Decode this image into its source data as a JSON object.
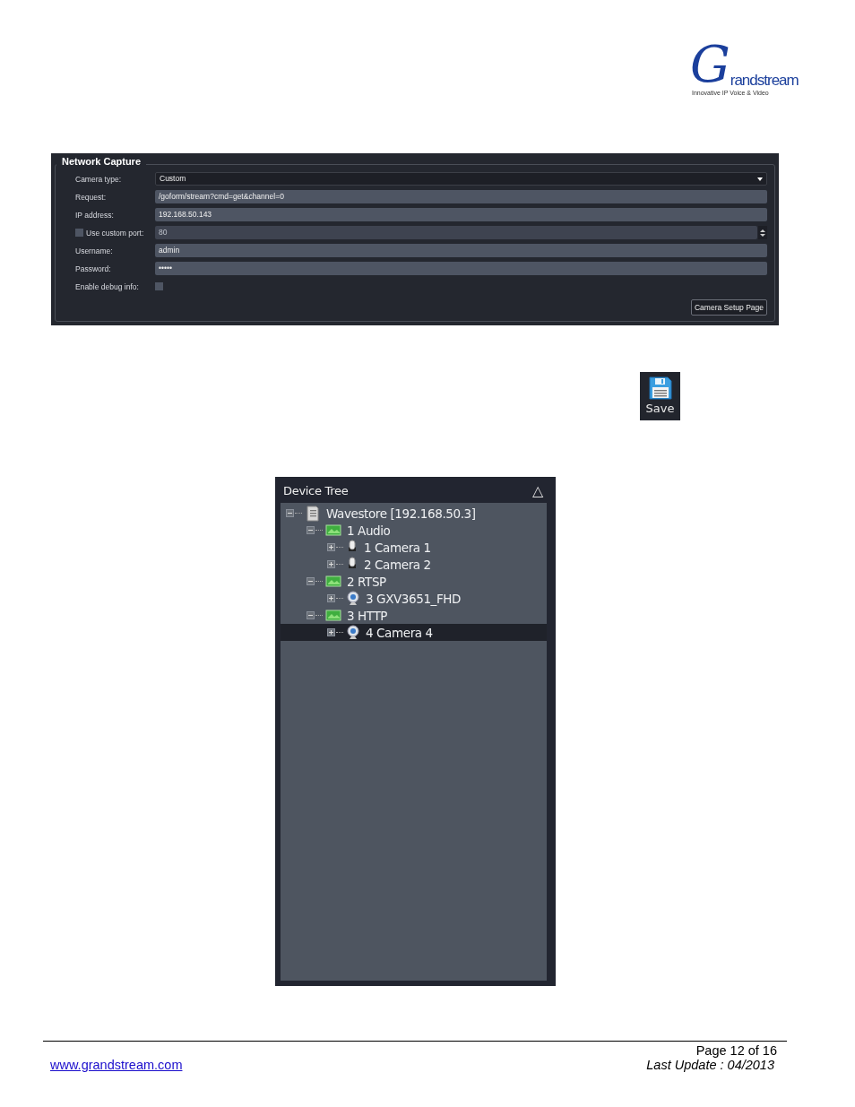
{
  "logo": {
    "initial": "G",
    "name": "randstream",
    "tagline": "Innovative IP Voice & Video"
  },
  "network_capture": {
    "title": "Network Capture",
    "fields": [
      {
        "label": "Camera type:",
        "kind": "select",
        "value": "Custom"
      },
      {
        "label": "Request:",
        "kind": "text",
        "value": "/goform/stream?cmd=get&channel=0"
      },
      {
        "label": "IP address:",
        "kind": "text",
        "value": "192.168.50.143"
      },
      {
        "label": "Use custom port:",
        "kind": "spin",
        "checked": false,
        "value": "80"
      },
      {
        "label": "Username:",
        "kind": "text",
        "value": "admin"
      },
      {
        "label": "Password:",
        "kind": "text",
        "value": "•••••"
      },
      {
        "label": "Enable debug info:",
        "kind": "check",
        "checked": false
      }
    ],
    "button": "Camera Setup Page"
  },
  "save_button": {
    "label": "Save"
  },
  "device_tree": {
    "title": "Device Tree",
    "collapse_glyph": "△",
    "items": [
      {
        "label": "Wavestore [192.168.50.3]",
        "kind": "server",
        "expanded": true,
        "selected": false,
        "children": [
          {
            "label": "1 Audio",
            "kind": "group",
            "expanded": true,
            "selected": false,
            "children": [
              {
                "label": "1 Camera 1",
                "kind": "mic",
                "expanded": false,
                "selected": false
              },
              {
                "label": "2 Camera 2",
                "kind": "mic",
                "expanded": false,
                "selected": false
              }
            ]
          },
          {
            "label": "2 RTSP",
            "kind": "group",
            "expanded": true,
            "selected": false,
            "children": [
              {
                "label": "3 GXV3651_FHD",
                "kind": "webcam",
                "expanded": false,
                "selected": false
              }
            ]
          },
          {
            "label": "3 HTTP",
            "kind": "group",
            "expanded": true,
            "selected": false,
            "children": [
              {
                "label": "4 Camera 4",
                "kind": "webcam",
                "expanded": false,
                "selected": true
              }
            ]
          }
        ]
      }
    ]
  },
  "footer": {
    "page": "Page 12 of 16",
    "link": "www.grandstream.com",
    "last_update": "Last Update : 04/2013"
  }
}
